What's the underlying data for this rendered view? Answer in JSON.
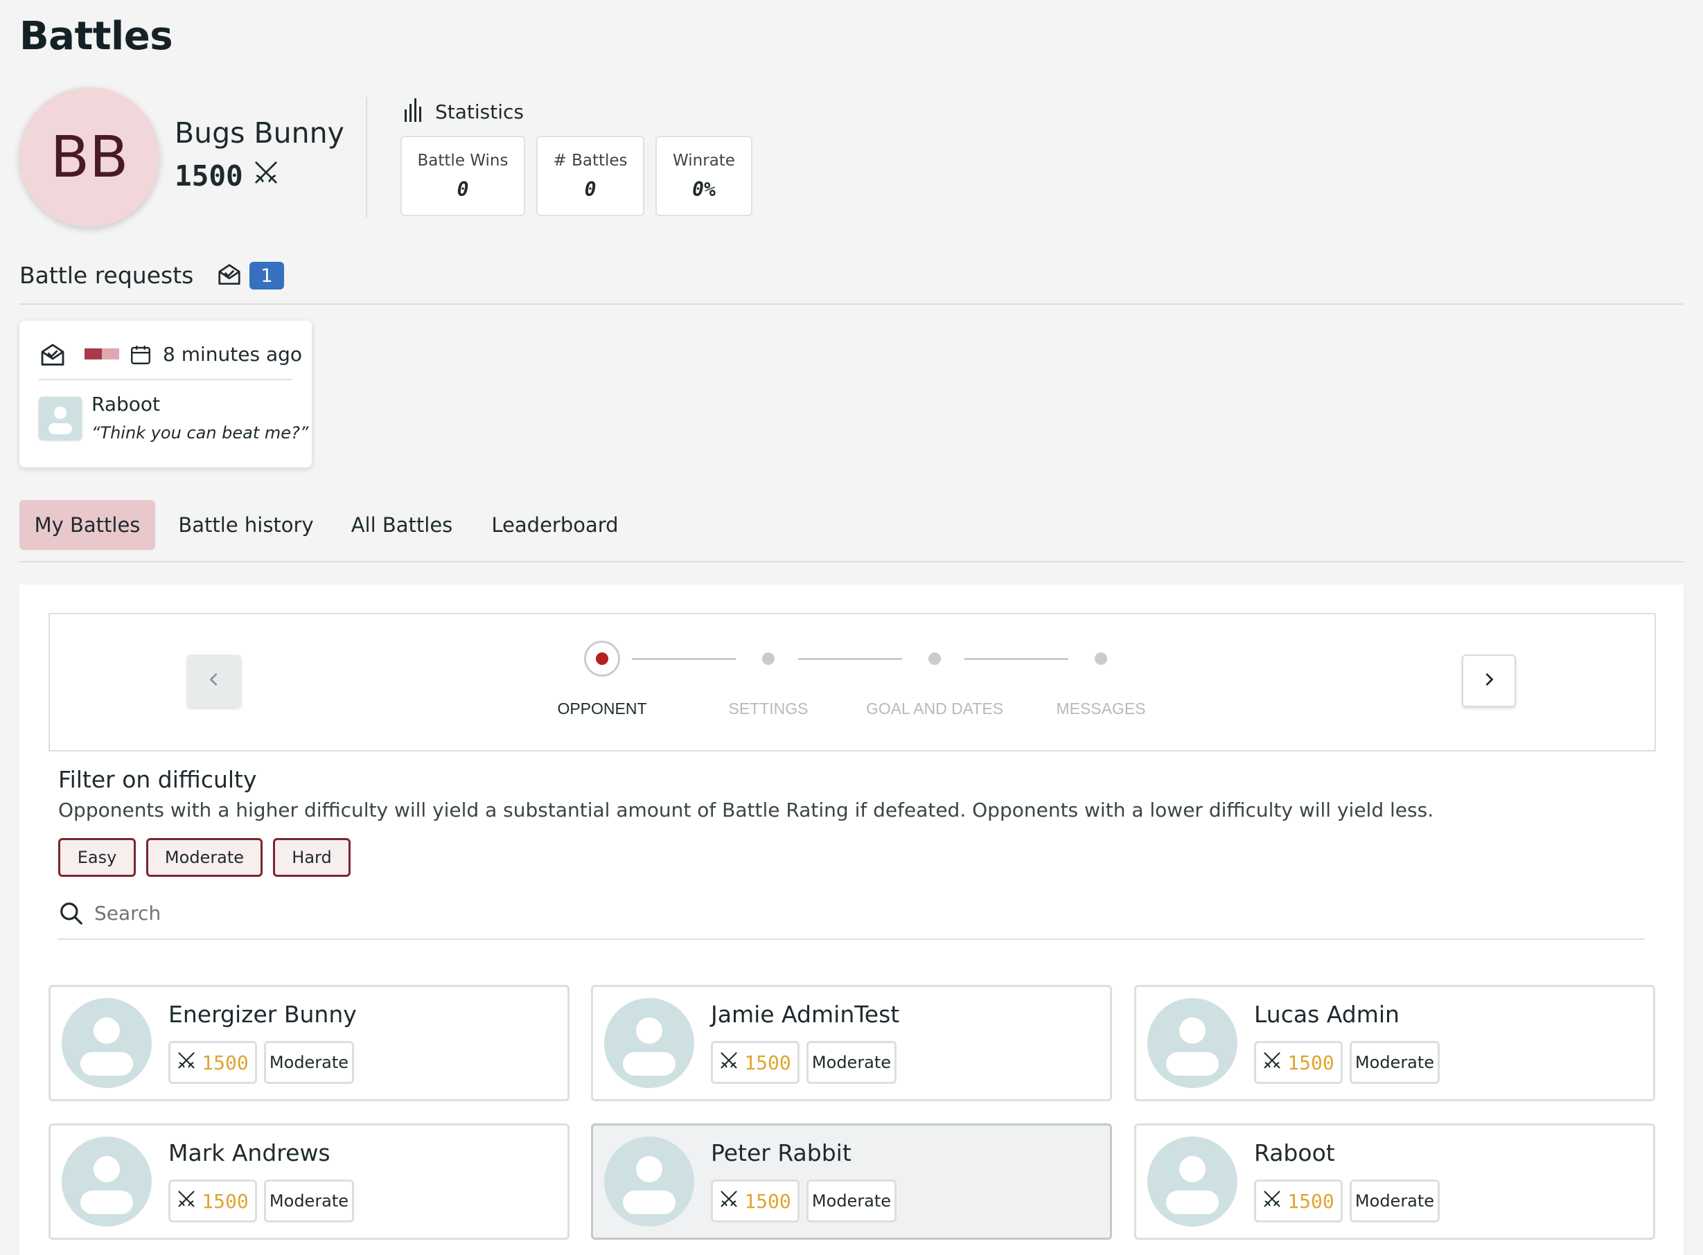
{
  "page": {
    "title": "Battles"
  },
  "profile": {
    "initials": "BB",
    "name": "Bugs Bunny",
    "rating": "1500"
  },
  "statistics": {
    "heading": "Statistics",
    "cards": [
      {
        "label": "Battle Wins",
        "value": "0"
      },
      {
        "label": "# Battles",
        "value": "0"
      },
      {
        "label": "Winrate",
        "value": "0%"
      }
    ]
  },
  "battle_requests": {
    "title": "Battle requests",
    "count": "1",
    "items": [
      {
        "time": "8 minutes ago",
        "name": "Raboot",
        "message": "“Think you can beat me?”"
      }
    ]
  },
  "tabs": [
    {
      "label": "My Battles",
      "active": true
    },
    {
      "label": "Battle history",
      "active": false
    },
    {
      "label": "All Battles",
      "active": false
    },
    {
      "label": "Leaderboard",
      "active": false
    }
  ],
  "stepper": {
    "steps": [
      {
        "label": "OPPONENT",
        "active": true
      },
      {
        "label": "SETTINGS",
        "active": false
      },
      {
        "label": "GOAL AND DATES",
        "active": false
      },
      {
        "label": "MESSAGES",
        "active": false
      }
    ]
  },
  "filter": {
    "title": "Filter on difficulty",
    "description": "Opponents with a higher difficulty will yield a substantial amount of Battle Rating if defeated. Opponents with a lower difficulty will yield less.",
    "chips": [
      "Easy",
      "Moderate",
      "Hard"
    ]
  },
  "search": {
    "placeholder": "Search",
    "value": ""
  },
  "opponents": [
    {
      "name": "Energizer Bunny",
      "rating": "1500",
      "difficulty": "Moderate"
    },
    {
      "name": "Jamie AdminTest",
      "rating": "1500",
      "difficulty": "Moderate"
    },
    {
      "name": "Lucas Admin",
      "rating": "1500",
      "difficulty": "Moderate"
    },
    {
      "name": "Mark Andrews",
      "rating": "1500",
      "difficulty": "Moderate"
    },
    {
      "name": "Peter Rabbit",
      "rating": "1500",
      "difficulty": "Moderate",
      "selected": true
    },
    {
      "name": "Raboot",
      "rating": "1500",
      "difficulty": "Moderate"
    }
  ],
  "icons": {
    "rating": "crossed-swords-icon",
    "statistics": "bar-chart-icon",
    "request": "envelope-open-icon",
    "date": "calendar-icon",
    "search": "search-icon",
    "prev": "chevron-left-icon",
    "next": "chevron-right-icon",
    "avatar": "user-placeholder-icon"
  },
  "colors": {
    "accent": "#e8c8cb",
    "badge": "#3770be",
    "active_step": "#b52020",
    "rating": "#e0a431",
    "chip_border": "#7a2630"
  }
}
